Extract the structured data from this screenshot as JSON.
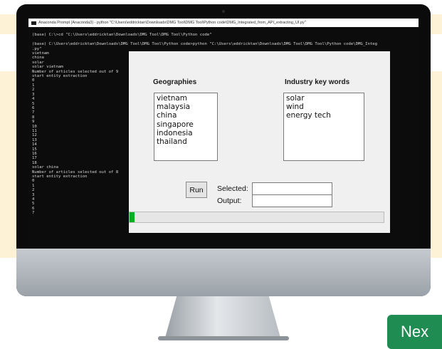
{
  "terminal": {
    "title": "Anaconda Prompt (Anaconda3) - python \"C:\\Users\\eddricktan\\Downloads\\DMG Tool\\DMG Tool\\Python code\\DMG_Integrated_from_API_extracting_UI.py\"",
    "lines": [
      "",
      "(base) C:\\>cd \"C:\\Users\\eddricktan\\Downloads\\DMG Tool\\DMG Tool\\Python code\"",
      "",
      "(base) C:\\Users\\eddricktan\\Downloads\\DMG Tool\\DMG Tool\\Python code>python \"C:\\Users\\eddricktan\\Downloads\\DMG Tool\\DMG Tool\\Python code\\DMG_Integ",
      ".py\"",
      "vietnam",
      "china",
      "solar",
      "solar vietnam",
      "Number of articles selected out of 9",
      "start entity extraction",
      "0",
      "1",
      "2",
      "3",
      "4",
      "5",
      "6",
      "7",
      "8",
      "9",
      "10",
      "11",
      "12",
      "13",
      "14",
      "15",
      "16",
      "17",
      "18",
      "solar china",
      "Number of articles selected out of 8",
      "start entity extraction",
      "0",
      "1",
      "2",
      "3",
      "4",
      "5",
      "6",
      "7"
    ]
  },
  "app": {
    "geographies_label": "Geographies",
    "industry_label": "Industry key words",
    "geographies": [
      "vietnam",
      "malaysia",
      "china",
      "singapore",
      "indonesia",
      "thailand"
    ],
    "industry_keywords": [
      "solar",
      "wind",
      "energy tech"
    ],
    "run_label": "Run",
    "selected_label": "Selected:",
    "output_label": "Output:",
    "selected_value": "",
    "output_value": "",
    "progress_fraction": 0.02,
    "progress_color": "#06b025"
  },
  "next_button": {
    "label": "Nex"
  },
  "colors": {
    "band": "#fdf2d6",
    "next_button": "#1f8c52",
    "terminal_bg": "#0c0c0c"
  }
}
